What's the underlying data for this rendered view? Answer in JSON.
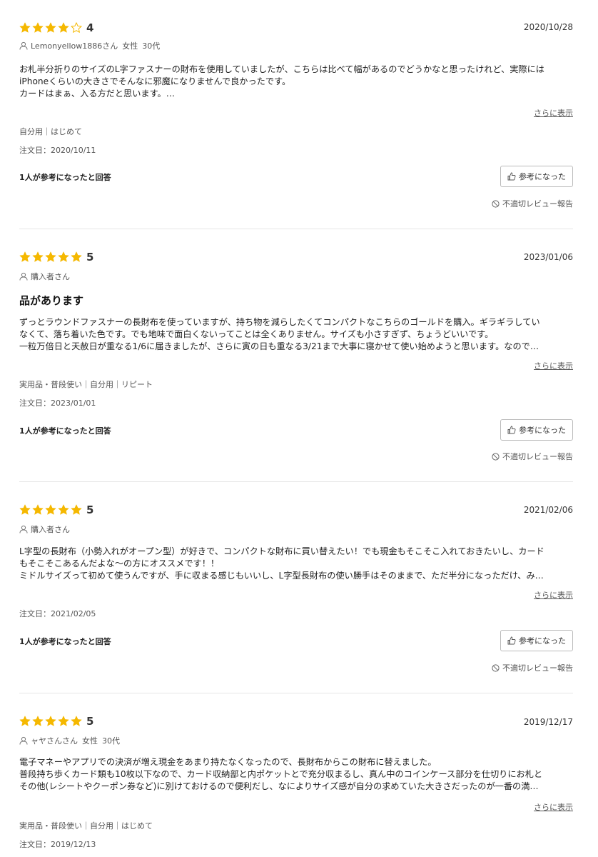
{
  "colors": {
    "star": "#F5B800",
    "star_empty": "#F5B800",
    "divider": "#e6e6e6"
  },
  "icons": {
    "star": "star-icon",
    "user": "user-icon",
    "thumb": "thumbs-up-icon",
    "report": "prohibit-icon"
  },
  "labels": {
    "more": "さらに表示",
    "helpful_button": "参考になった",
    "report": "不適切レビュー報告"
  },
  "reviews": [
    {
      "rating": 4,
      "score": "4",
      "date": "2020/10/28",
      "user": "Lemonyellow1886さん",
      "gender": "女性",
      "age": "30代",
      "title": "",
      "body": [
        "お札半分折りのサイズのL字ファスナーの財布を使用していましたが、こちらは比べて幅があるのでどうかなと思ったけれど、実際には",
        "iPhoneくらいの大きさでそんなに邪魔になりませんで良かったです。",
        "カードはまぁ、入る方だと思います。…"
      ],
      "tags": "自分用｜はじめて",
      "order_date": "注文日：2020/10/11",
      "helpful": "1人が参考になったと回答"
    },
    {
      "rating": 5,
      "score": "5",
      "date": "2023/01/06",
      "user": "購入者さん",
      "gender": "",
      "age": "",
      "title": "品があります",
      "body": [
        "ずっとラウンドファスナーの長財布を使っていますが、持ち物を減らしたくてコンパクトなこちらのゴールドを購入。ギラギラしてい",
        "なくて、落ち着いた色です。でも地味で面白くないってことは全くありません。サイズも小さすぎず、ちょうどいいです。",
        "一粒万倍日と天赦日が重なる1/6に届きましたが、さらに寅の日も重なる3/21まで大事に寝かせて使い始めようと思います。なので…"
      ],
      "tags": "実用品・普段使い｜自分用｜リピート",
      "order_date": "注文日：2023/01/01",
      "helpful": "1人が参考になったと回答"
    },
    {
      "rating": 5,
      "score": "5",
      "date": "2021/02/06",
      "user": "購入者さん",
      "gender": "",
      "age": "",
      "title": "",
      "body": [
        "L字型の長財布（小勢入れがオープン型）が好きで、コンパクトな財布に買い替えたい！でも現金もそこそこ入れておきたいし、カード",
        "もそこそこあるんだよな〜の方にオススメです！！",
        "ミドルサイズって初めて使うんですが、手に収まる感じもいいし、L字型長財布の使い勝手はそのままで、ただ半分になっただけ、み…"
      ],
      "tags": "",
      "order_date": "注文日：2021/02/05",
      "helpful": "1人が参考になったと回答"
    },
    {
      "rating": 5,
      "score": "5",
      "date": "2019/12/17",
      "user": "ャヤさんさん",
      "gender": "女性",
      "age": "30代",
      "title": "",
      "body": [
        "電子マネーやアプリでの決済が増え現金をあまり持たなくなったので、長財布からこの財布に替えました。",
        "普段持ち歩くカード類も10枚以下なので、カード収納部と内ポケットとで充分収まるし、真ん中のコインケース部分を仕切りにお札と",
        "その他(レシートやクーポン券など)に別けておけるので便利だし、なによりサイズ感が自分の求めていた大きさだったのが一番の満…"
      ],
      "tags": "実用品・普段使い｜自分用｜はじめて",
      "order_date": "注文日：2019/12/13",
      "helpful": ""
    }
  ]
}
